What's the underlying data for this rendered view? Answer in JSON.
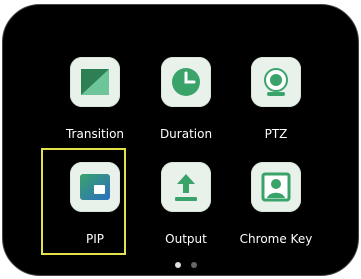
{
  "grid": {
    "items": [
      {
        "label": "Transition",
        "icon": "transition-icon"
      },
      {
        "label": "Duration",
        "icon": "clock-icon"
      },
      {
        "label": "PTZ",
        "icon": "camera-icon"
      },
      {
        "label": "PIP",
        "icon": "pip-icon",
        "selected": true
      },
      {
        "label": "Output",
        "icon": "upload-icon"
      },
      {
        "label": "Chrome Key",
        "icon": "portrait-icon"
      }
    ]
  },
  "pagination": {
    "current_page": 1,
    "total_pages": 2
  },
  "colors": {
    "accent_green": "#3aa36a",
    "tile_bg": "#e8f2ea",
    "selection": "#e3e24a",
    "background": "#000000"
  }
}
